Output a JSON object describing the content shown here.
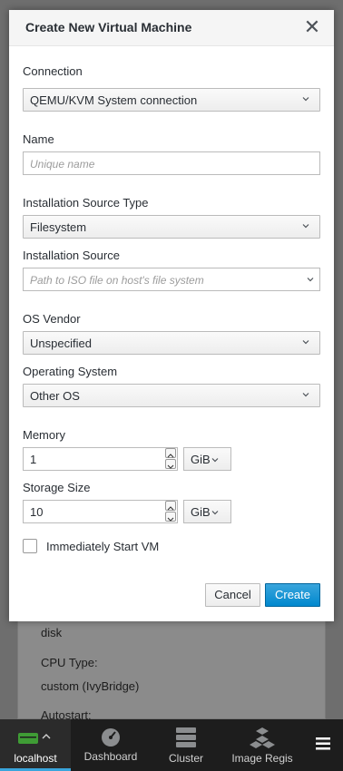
{
  "background": {
    "disk_text": "disk",
    "cpu_type_label": "CPU Type:",
    "cpu_type_value": "custom (IvyBridge)",
    "autostart_label": "Autostart:"
  },
  "modal": {
    "title": "Create New Virtual Machine",
    "connection": {
      "label": "Connection",
      "value": "QEMU/KVM System connection"
    },
    "name": {
      "label": "Name",
      "placeholder": "Unique name"
    },
    "install_source_type": {
      "label": "Installation Source Type",
      "value": "Filesystem"
    },
    "install_source": {
      "label": "Installation Source",
      "placeholder": "Path to ISO file on host's file system"
    },
    "os_vendor": {
      "label": "OS Vendor",
      "value": "Unspecified"
    },
    "operating_system": {
      "label": "Operating System",
      "value": "Other OS"
    },
    "memory": {
      "label": "Memory",
      "value": "1",
      "unit": "GiB"
    },
    "storage": {
      "label": "Storage Size",
      "value": "10",
      "unit": "GiB"
    },
    "start_vm": {
      "label": "Immediately Start VM",
      "checked": false
    },
    "cancel_label": "Cancel",
    "create_label": "Create"
  },
  "nav": {
    "items": [
      {
        "label": "localhost",
        "icon": "server-icon",
        "active": true
      },
      {
        "label": "Dashboard",
        "icon": "dashboard-icon",
        "active": false
      },
      {
        "label": "Cluster",
        "icon": "cluster-icon",
        "active": false
      },
      {
        "label": "Image Regis",
        "icon": "image-registry-icon",
        "active": false
      }
    ],
    "menu_icon": "hamburger-icon",
    "accent": "#39a5dc"
  }
}
